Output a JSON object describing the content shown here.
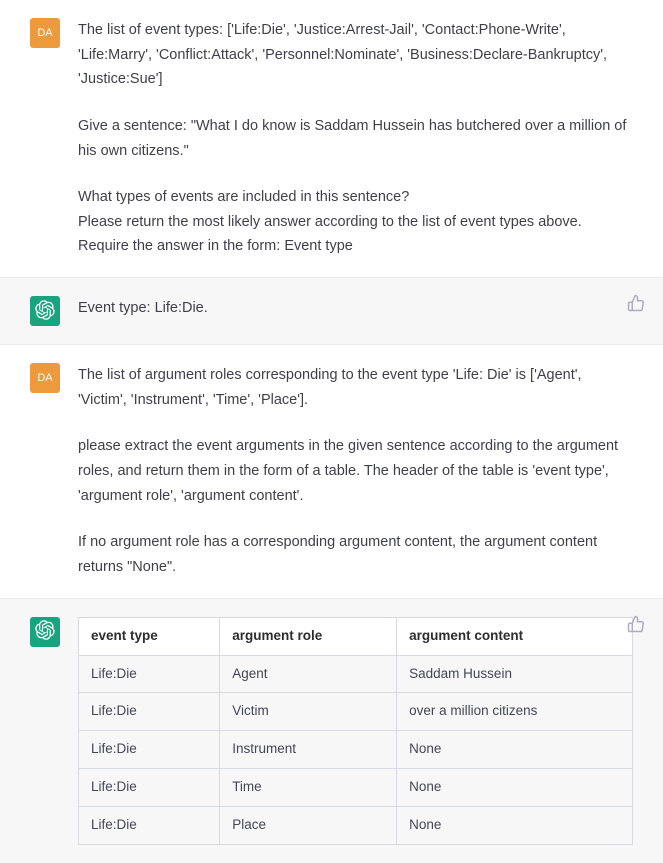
{
  "messages": [
    {
      "role": "user",
      "avatar_label": "DA",
      "paragraphs": [
        "The list of event types: ['Life:Die', 'Justice:Arrest-Jail', 'Contact:Phone-Write', 'Life:Marry', 'Conflict:Attack', 'Personnel:Nominate', 'Business:Declare-Bankruptcy', 'Justice:Sue']",
        "Give a sentence: \"What I do know is Saddam Hussein has butchered over a million of his own citizens.\"",
        "What types of events are included in this sentence?",
        "Please return the most likely answer according to the list of event types above.",
        "Require the answer in the form: Event type"
      ],
      "para_gaps": [
        false,
        true,
        true,
        false,
        false
      ]
    },
    {
      "role": "assistant",
      "paragraphs": [
        "Event type: Life:Die."
      ]
    },
    {
      "role": "user",
      "avatar_label": "DA",
      "paragraphs": [
        "The list of argument roles corresponding to the event type 'Life: Die' is ['Agent', 'Victim', 'Instrument', 'Time', 'Place'].",
        "please extract the event arguments in the given sentence according to the argument roles, and return them in the form of a table. The header of the table is 'event type', 'argument role', 'argument content'.",
        "If no argument role has a corresponding argument content, the argument content returns \"None\"."
      ],
      "para_gaps": [
        false,
        true,
        true
      ]
    },
    {
      "role": "assistant",
      "table": {
        "headers": [
          "event type",
          "argument role",
          "argument content"
        ],
        "rows": [
          [
            "Life:Die",
            "Agent",
            "Saddam Hussein"
          ],
          [
            "Life:Die",
            "Victim",
            "over a million citizens"
          ],
          [
            "Life:Die",
            "Instrument",
            "None"
          ],
          [
            "Life:Die",
            "Time",
            "None"
          ],
          [
            "Life:Die",
            "Place",
            "None"
          ]
        ]
      }
    }
  ]
}
